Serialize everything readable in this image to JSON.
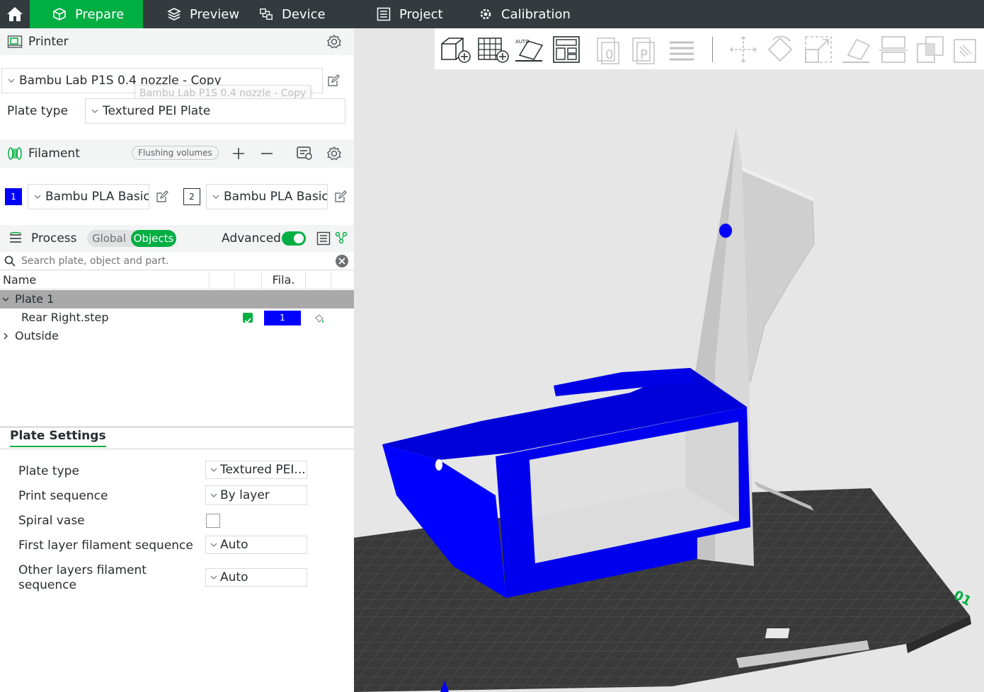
{
  "topbar": {
    "tabs": [
      {
        "label": "Prepare",
        "icon": "cube-outline-icon",
        "active": true
      },
      {
        "label": "Preview",
        "icon": "layers-icon"
      },
      {
        "label": "Device",
        "icon": "device-icon"
      },
      {
        "label": "Project",
        "icon": "list-icon"
      },
      {
        "label": "Calibration",
        "icon": "calibration-icon"
      }
    ]
  },
  "printer": {
    "section_title": "Printer",
    "selected": "Bambu Lab P1S 0.4 nozzle - Copy",
    "tooltip": "Bambu Lab P1S 0.4 nozzle - Copy",
    "plate_type_label": "Plate type",
    "plate_type_value": "Textured PEI Plate"
  },
  "filament": {
    "section_title": "Filament",
    "flushing_label": "Flushing volumes",
    "slots": [
      {
        "index": "1",
        "name": "Bambu PLA Basic",
        "color": "#0000ff"
      },
      {
        "index": "2",
        "name": "Bambu PLA Basic",
        "color": "#ffffff"
      }
    ]
  },
  "process": {
    "section_title": "Process",
    "global_label": "Global",
    "objects_label": "Objects",
    "advanced_label": "Advanced",
    "advanced_on": true
  },
  "search": {
    "placeholder": "Search plate, object and part."
  },
  "object_list": {
    "col_name": "Name",
    "col_fila": "Fila.",
    "plate": "Plate 1",
    "object": "Rear Right.step",
    "object_filament": "1",
    "outside": "Outside"
  },
  "plate_settings": {
    "tab": "Plate Settings",
    "rows": [
      {
        "label": "Plate type",
        "value": "Textured PEI..."
      },
      {
        "label": "Print sequence",
        "value": "By layer"
      },
      {
        "label": "Spiral vase",
        "value": ""
      },
      {
        "label": "First layer filament sequence",
        "value": "Auto"
      },
      {
        "label": "Other layers filament",
        "label2": "sequence",
        "value": "Auto"
      }
    ]
  },
  "viewport": {
    "plate_number": "01",
    "model_primary_color": "#0000ff",
    "model_secondary_color": "#d9d9d9",
    "bed_color": "#3a3a3a"
  }
}
